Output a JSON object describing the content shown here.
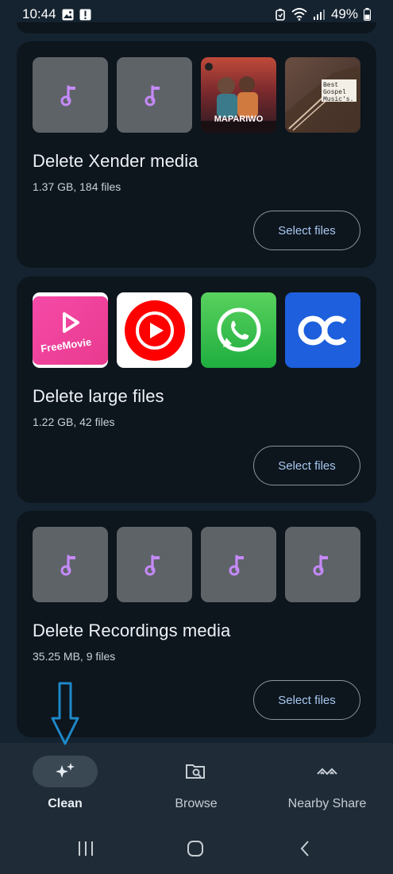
{
  "status_bar": {
    "time": "10:44",
    "battery": "49%"
  },
  "cards": [
    {
      "title": "Delete Xender media",
      "subtitle": "1.37 GB, 184 files",
      "button_label": "Select files",
      "thumbnails": [
        {
          "type": "music-note-icon"
        },
        {
          "type": "music-note-icon"
        },
        {
          "type": "album-art",
          "text": "MAPARIWO"
        },
        {
          "type": "album-art",
          "text": "Best Gospel Music's."
        }
      ]
    },
    {
      "title": "Delete large files",
      "subtitle": "1.22 GB, 42 files",
      "button_label": "Select files",
      "thumbnails": [
        {
          "type": "app-icon",
          "text": "FreeMovie"
        },
        {
          "type": "youtube-music-icon"
        },
        {
          "type": "whatsapp-icon"
        },
        {
          "type": "oc-app-icon"
        }
      ]
    },
    {
      "title": "Delete Recordings media",
      "subtitle": "35.25 MB, 9 files",
      "button_label": "Select files",
      "thumbnails": [
        {
          "type": "music-note-icon"
        },
        {
          "type": "music-note-icon"
        },
        {
          "type": "music-note-icon"
        },
        {
          "type": "music-note-icon"
        }
      ]
    }
  ],
  "bottom_nav": {
    "items": [
      {
        "label": "Clean",
        "icon": "sparkle-icon",
        "active": true
      },
      {
        "label": "Browse",
        "icon": "folder-search-icon",
        "active": false
      },
      {
        "label": "Nearby Share",
        "icon": "nearby-share-icon",
        "active": false
      }
    ]
  },
  "colors": {
    "background": "#152330",
    "card": "#0d151d",
    "accent_text": "#a8c8f0",
    "music_note": "#c58af9",
    "annotation_arrow": "#1e88c8"
  }
}
